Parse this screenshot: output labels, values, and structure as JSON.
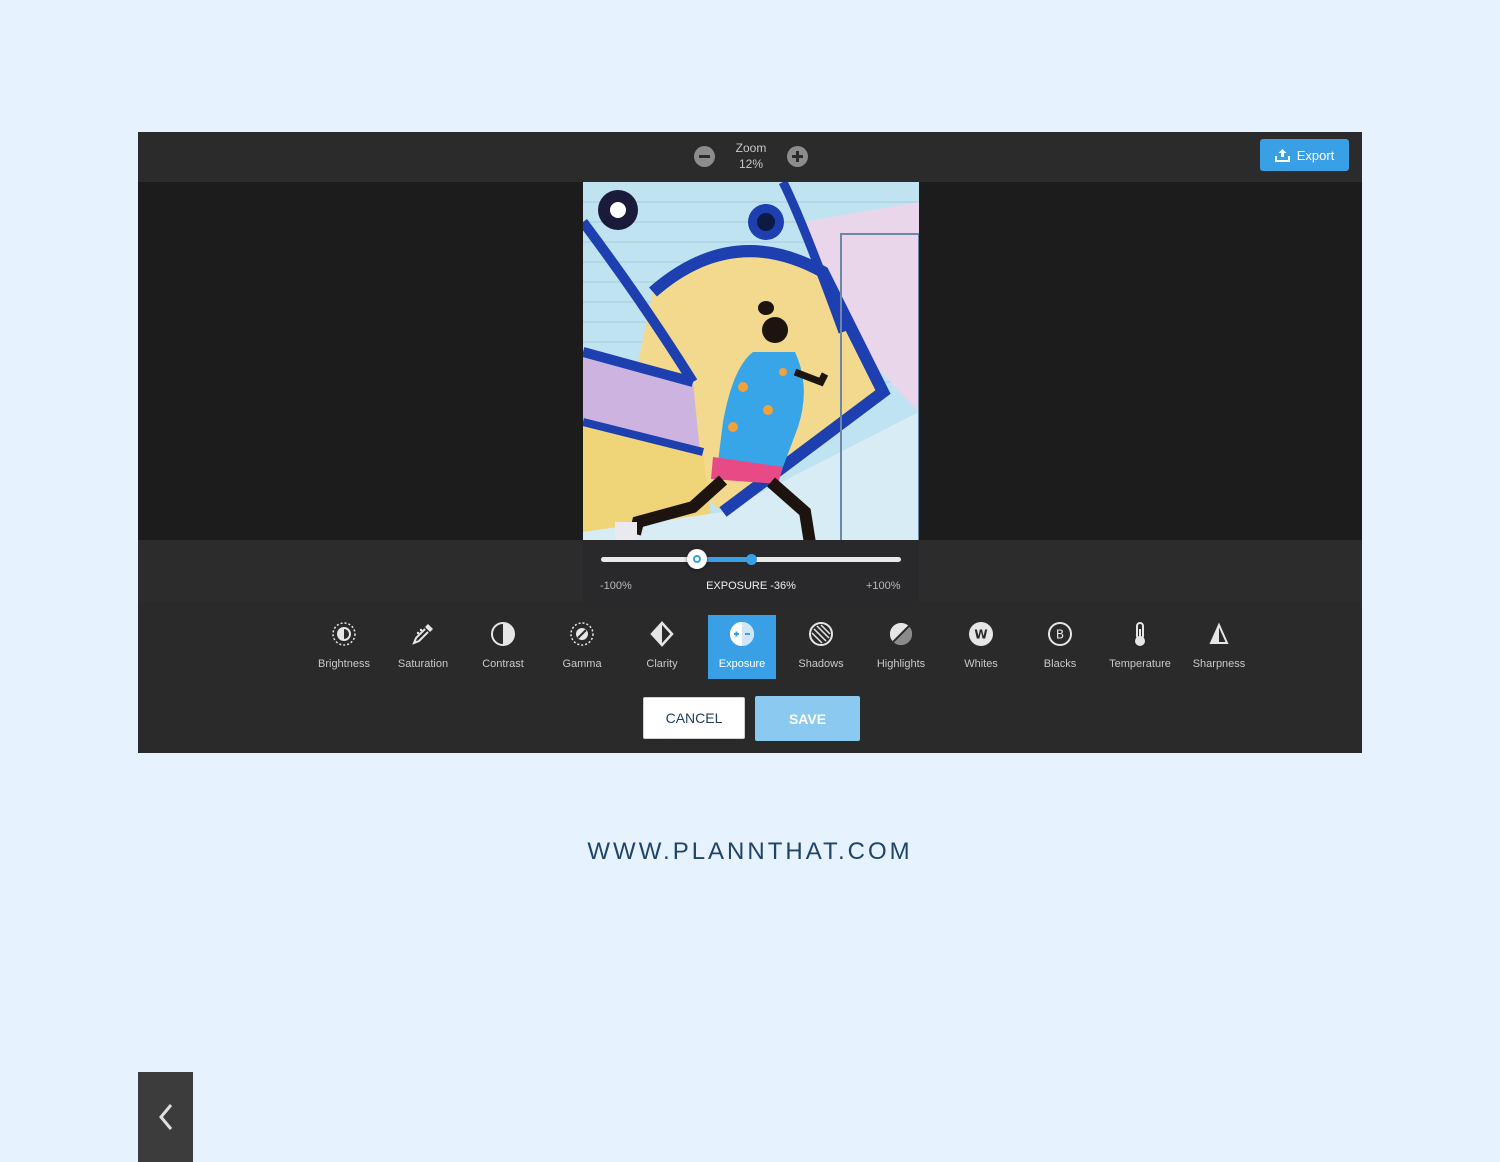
{
  "zoom": {
    "label": "Zoom",
    "value": "12%"
  },
  "export": {
    "label": "Export",
    "icon": "upload-icon"
  },
  "adjustment": {
    "name": "EXPOSURE",
    "value_label": "EXPOSURE -36%",
    "value_percent": -36,
    "min_label": "-100%",
    "max_label": "+100%"
  },
  "tools": [
    {
      "label": "Brightness",
      "icon": "brightness-icon"
    },
    {
      "label": "Saturation",
      "icon": "dropper-icon"
    },
    {
      "label": "Contrast",
      "icon": "contrast-icon"
    },
    {
      "label": "Gamma",
      "icon": "gamma-icon"
    },
    {
      "label": "Clarity",
      "icon": "clarity-icon"
    },
    {
      "label": "Exposure",
      "icon": "exposure-icon",
      "active": true
    },
    {
      "label": "Shadows",
      "icon": "shadows-icon"
    },
    {
      "label": "Highlights",
      "icon": "highlights-icon"
    },
    {
      "label": "Whites",
      "icon": "whites-icon",
      "glyph": "W"
    },
    {
      "label": "Blacks",
      "icon": "blacks-icon",
      "glyph": "B"
    },
    {
      "label": "Temperature",
      "icon": "thermometer-icon"
    },
    {
      "label": "Sharpness",
      "icon": "sharpness-icon"
    }
  ],
  "actions": {
    "cancel": "CANCEL",
    "save": "SAVE"
  },
  "footer": {
    "url": "WWW.PLANNTHAT.COM"
  },
  "colors": {
    "accent": "#3aa0e6",
    "save_disabled": "#8cc9f0",
    "background": "#e6f2fd"
  }
}
